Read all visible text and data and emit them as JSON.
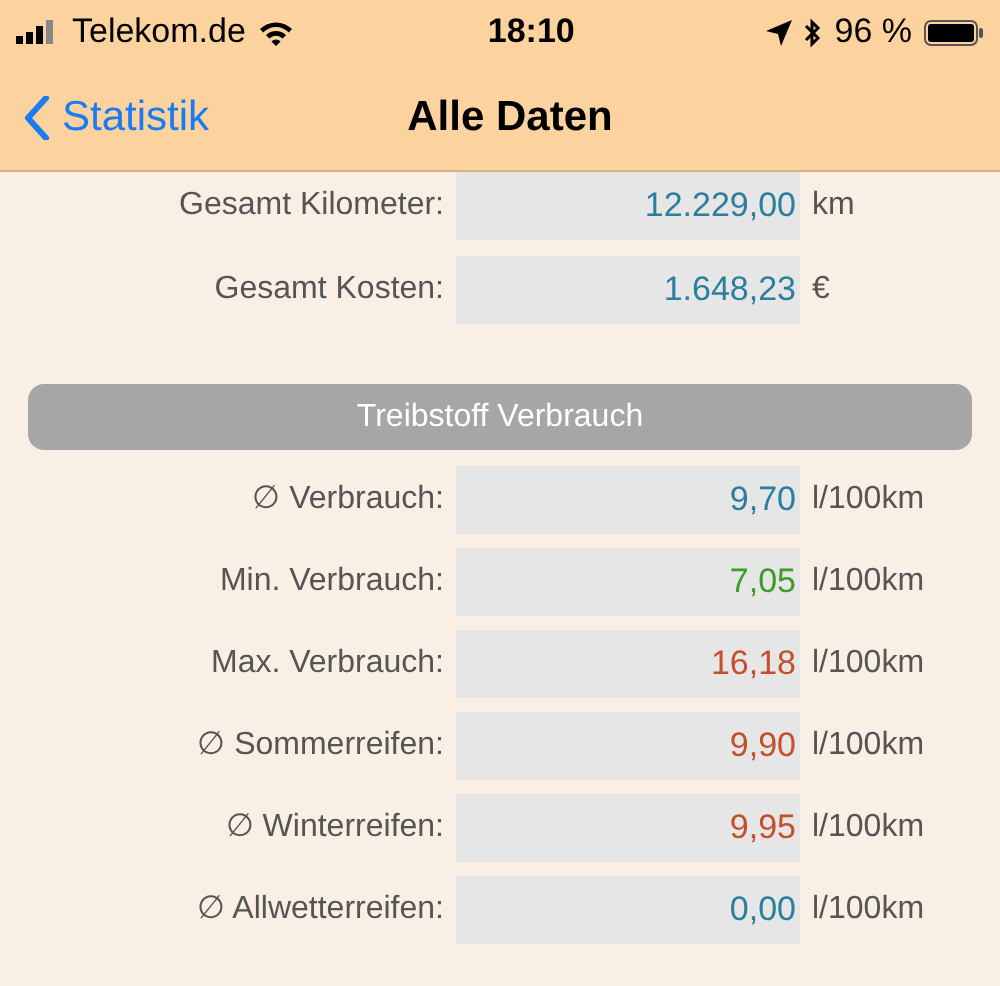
{
  "status_bar": {
    "carrier": "Telekom.de",
    "time": "18:10",
    "battery": "96 %"
  },
  "nav_bar": {
    "back": "Statistik",
    "title": "Alle Daten"
  },
  "totals": [
    {
      "label": "Gesamt Kilometer:",
      "value": "12.229,00",
      "unit": "km",
      "color": "#2b7f9c"
    },
    {
      "label": "Gesamt Kosten:",
      "value": "1.648,23",
      "unit": "€",
      "color": "#2b7f9c"
    }
  ],
  "section_button": "Treibstoff Verbrauch",
  "consumption": [
    {
      "label": "∅ Verbrauch:",
      "value": "9,70",
      "unit": "l/100km",
      "color": "#2b7f9c"
    },
    {
      "label": "Min. Verbrauch:",
      "value": "7,05",
      "unit": "l/100km",
      "color": "#3f9a2e"
    },
    {
      "label": "Max. Verbrauch:",
      "value": "16,18",
      "unit": "l/100km",
      "color": "#c2502c"
    },
    {
      "label": "∅ Sommerreifen:",
      "value": "9,90",
      "unit": "l/100km",
      "color": "#c2502c"
    },
    {
      "label": "∅ Winterreifen:",
      "value": "9,95",
      "unit": "l/100km",
      "color": "#c2502c"
    },
    {
      "label": "∅ Allwetterreifen:",
      "value": "0,00",
      "unit": "l/100km",
      "color": "#2b7f9c"
    }
  ]
}
